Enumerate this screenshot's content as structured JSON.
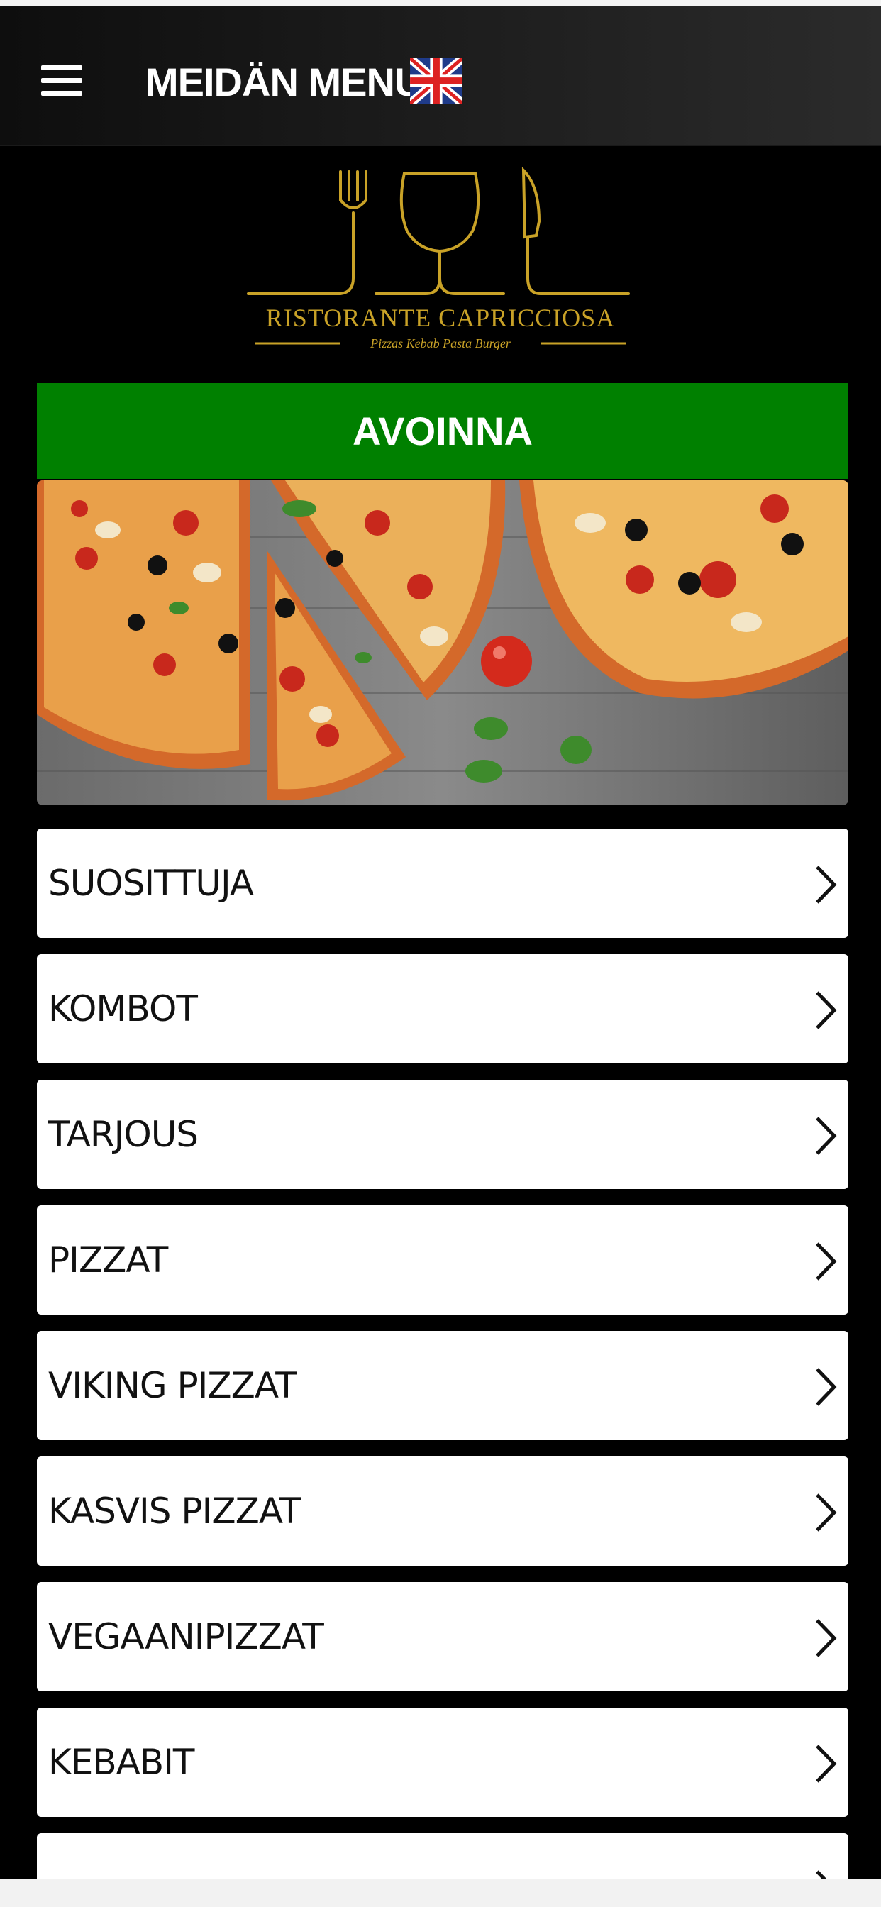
{
  "header": {
    "menu_icon": "hamburger-icon",
    "title": "MEIDÄN MENU",
    "language_icon": "uk-flag-icon"
  },
  "brand": {
    "name": "RISTORANTE CAPRICCIOSA",
    "tagline": "Pizzas Kebab Pasta Burger",
    "logo_icons": [
      "fork-icon",
      "wine-glass-icon",
      "knife-icon"
    ],
    "gold": "#c9a227"
  },
  "status": {
    "label": "AVOINNA",
    "color": "#008000"
  },
  "hero_image": "pizza-photo",
  "menu": {
    "items": [
      {
        "label": "SUOSITTUJA"
      },
      {
        "label": "KOMBOT"
      },
      {
        "label": "TARJOUS"
      },
      {
        "label": "PIZZAT"
      },
      {
        "label": "VIKING PIZZAT"
      },
      {
        "label": "KASVIS PIZZAT"
      },
      {
        "label": "VEGAANIPIZZAT"
      },
      {
        "label": "KEBABIT"
      },
      {
        "label": ""
      }
    ],
    "chevron_icon": "chevron-right-icon"
  }
}
